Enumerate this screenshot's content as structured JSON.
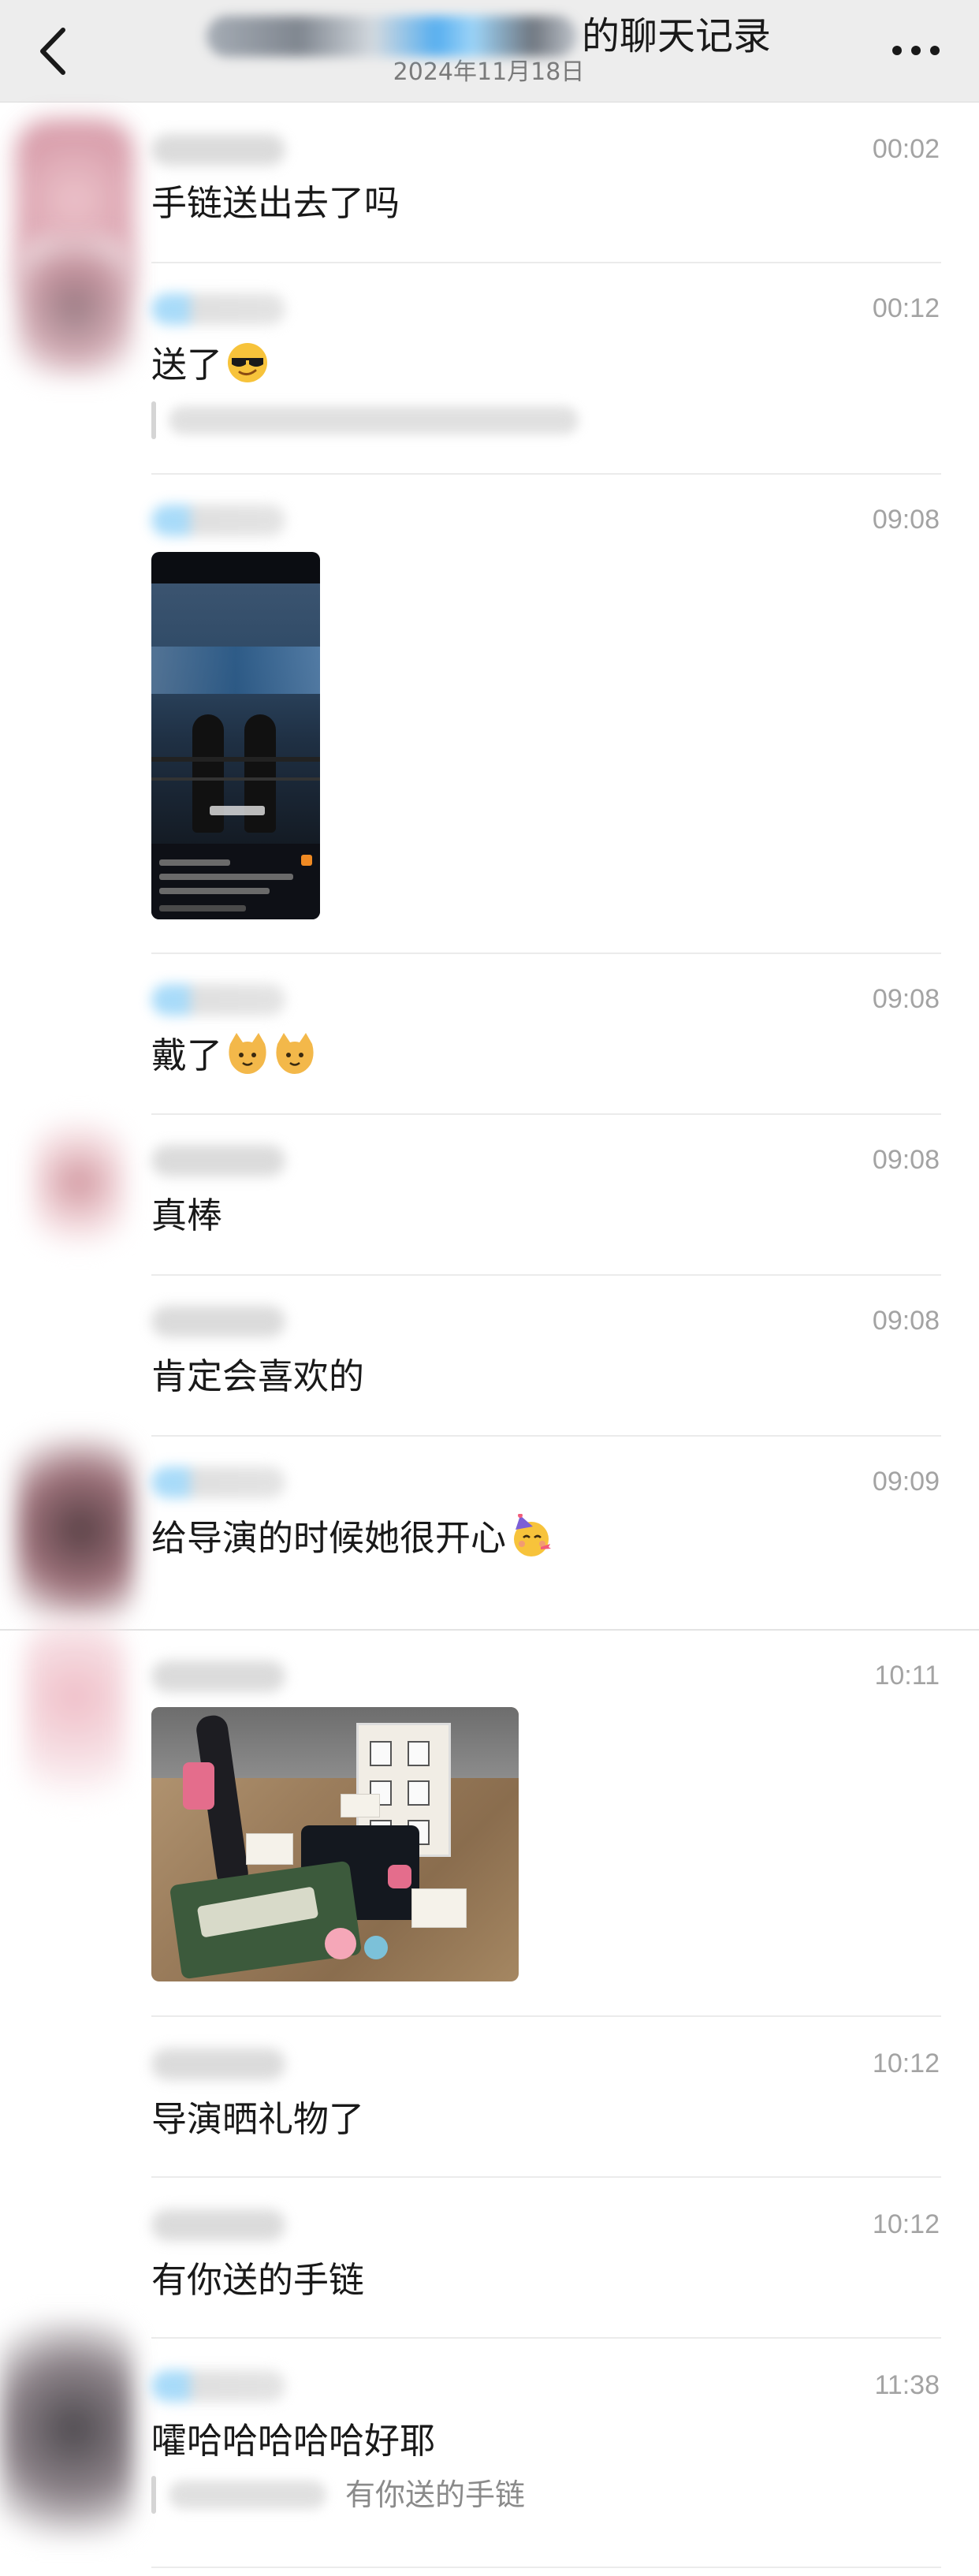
{
  "header": {
    "title_suffix": "的聊天记录",
    "date": "2024年11月18日",
    "back_icon": "chevron-left-icon",
    "more_icon": "more-dots-icon"
  },
  "messages": [
    {
      "time": "00:02",
      "text": "手链送出去了吗"
    },
    {
      "time": "00:12",
      "text": "送了",
      "emoji": "cool-sunglasses-emoji"
    },
    {
      "time": "09:08",
      "image": "phone-screenshot-thumbnail"
    },
    {
      "time": "09:08",
      "text": "戴了",
      "emoji": "cat-emoji"
    },
    {
      "time": "09:08",
      "text": "真棒"
    },
    {
      "time": "09:08",
      "text": "肯定会喜欢的"
    },
    {
      "time": "09:09",
      "text": "给导演的时候她很开心",
      "emoji": "party-face-emoji"
    },
    {
      "time": "10:11",
      "image": "gift-photo-thumbnail"
    },
    {
      "time": "10:12",
      "text": "导演晒礼物了"
    },
    {
      "time": "10:12",
      "text": "有你送的手链"
    },
    {
      "time": "11:38",
      "text": "嚯哈哈哈哈哈好耶",
      "quote": "有你送的手链"
    }
  ],
  "colors": {
    "header_bg": "#ededed",
    "text": "#191919",
    "time": "#a3a3a3",
    "divider": "#ebebeb",
    "accent_blue": "#8ccff7"
  }
}
